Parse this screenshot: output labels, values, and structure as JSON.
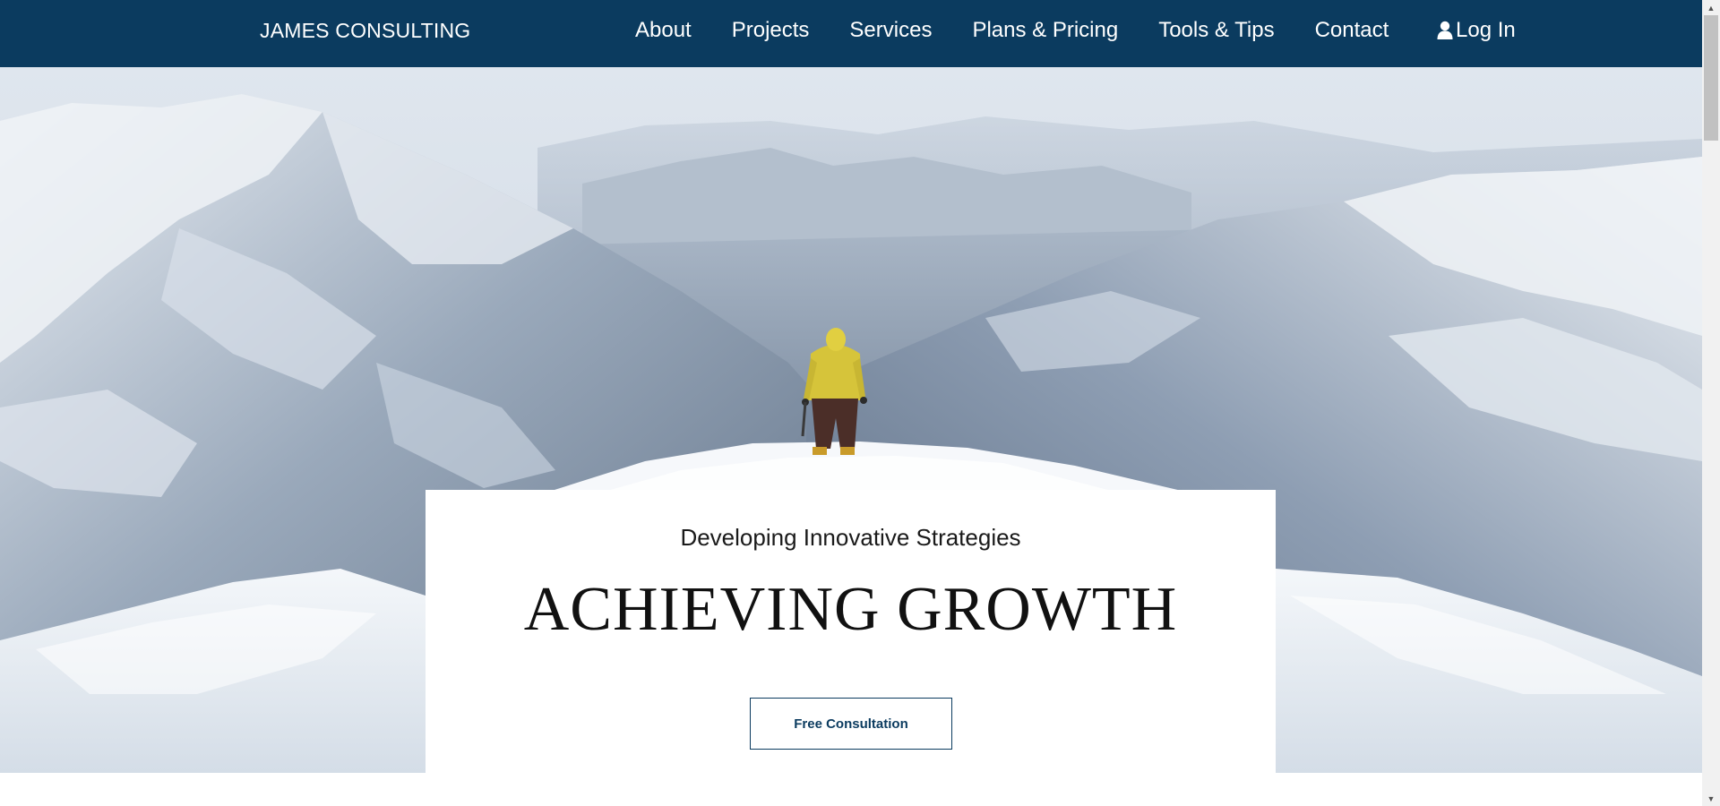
{
  "nav": {
    "brand": "JAMES CONSULTING",
    "items": [
      {
        "label": "About",
        "name": "nav-about"
      },
      {
        "label": "Projects",
        "name": "nav-projects"
      },
      {
        "label": "Services",
        "name": "nav-services"
      },
      {
        "label": "Plans & Pricing",
        "name": "nav-plans-pricing"
      },
      {
        "label": "Tools & Tips",
        "name": "nav-tools-tips"
      },
      {
        "label": "Contact",
        "name": "nav-contact"
      }
    ],
    "login_label": "Log In",
    "login_icon": "user-icon"
  },
  "hero": {
    "subtitle": "Developing Innovative Strategies",
    "title": "ACHIEVING GROWTH",
    "cta_label": "Free Consultation",
    "image_description_icon": "mountain-hiker-image"
  },
  "colors": {
    "nav_background": "#0b3b5f",
    "nav_text": "#ffffff",
    "cta_border": "#0b3b5f",
    "card_background": "#ffffff"
  }
}
